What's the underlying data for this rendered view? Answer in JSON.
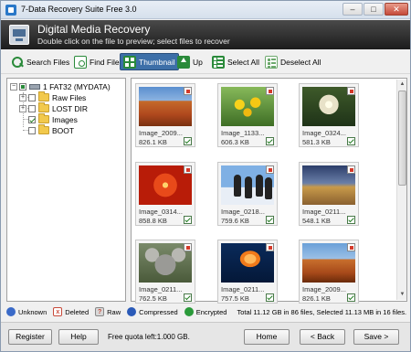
{
  "window": {
    "title": "7-Data Recovery Suite Free 3.0",
    "min": "–",
    "max": "□",
    "close": "✕"
  },
  "banner": {
    "title": "Digital Media Recovery",
    "subtitle": "Double click on the file to preview; select files to recover"
  },
  "toolbar": {
    "search_files": "Search Files",
    "find_file": "Find File",
    "thumbnail": "Thumbnail",
    "up": "Up",
    "select_all": "Select All",
    "deselect_all": "Deselect All"
  },
  "tree": {
    "root": "1 FAT32 (MYDATA)",
    "items": [
      "Raw Files",
      "LOST DIR",
      "Images",
      "BOOT"
    ]
  },
  "thumbnails": [
    {
      "name": "Image_2009...",
      "size": "826.1 KB"
    },
    {
      "name": "Image_1133...",
      "size": "606.3 KB"
    },
    {
      "name": "Image_0324...",
      "size": "581.3 KB"
    },
    {
      "name": "Image_0314...",
      "size": "858.8 KB"
    },
    {
      "name": "Image_0218...",
      "size": "759.6 KB"
    },
    {
      "name": "Image_0211...",
      "size": "548.1 KB"
    },
    {
      "name": "Image_0211...",
      "size": "762.5 KB"
    },
    {
      "name": "Image_0211...",
      "size": "757.5 KB"
    },
    {
      "name": "Image_2009...",
      "size": "826.1 KB"
    }
  ],
  "legend": {
    "unknown": "Unknown",
    "deleted": "Deleted",
    "raw": "Raw",
    "compressed": "Compressed",
    "encrypted": "Encrypted",
    "raw_glyph": "?",
    "deleted_glyph": "x",
    "total": "Total 11.12 GB in 86 files, Selected 11.13 MB in 16 files."
  },
  "bottom": {
    "register": "Register",
    "help": "Help",
    "quota": "Free quota left:1.000 GB.",
    "home": "Home",
    "back": "< Back",
    "save": "Save >"
  },
  "scrollbar": {
    "up": "▲",
    "down": "▼"
  },
  "splitter": "⋮"
}
